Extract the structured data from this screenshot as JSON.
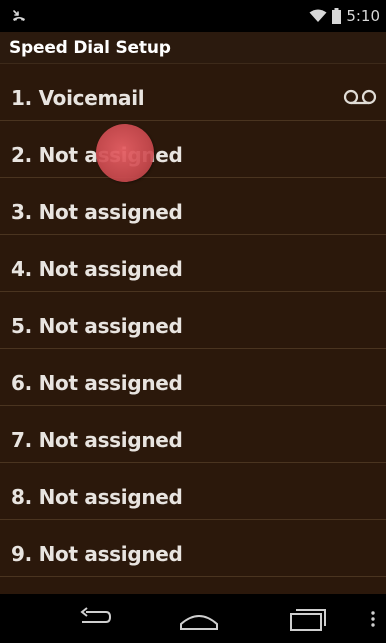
{
  "status_bar": {
    "time": "5:10",
    "left_icon": "missed-call-icon",
    "wifi_icon": "wifi-icon",
    "battery_icon": "battery-icon"
  },
  "action_bar": {
    "title": "Speed Dial Setup"
  },
  "speed_dial": {
    "items": [
      {
        "label": "1. Voicemail",
        "icon": "voicemail-icon"
      },
      {
        "label": "2. Not assigned"
      },
      {
        "label": "3. Not assigned"
      },
      {
        "label": "4. Not assigned"
      },
      {
        "label": "5. Not assigned"
      },
      {
        "label": "6. Not assigned"
      },
      {
        "label": "7. Not assigned"
      },
      {
        "label": "8. Not assigned"
      },
      {
        "label": "9. Not assigned"
      }
    ]
  },
  "navigation_bar": {
    "back_icon": "back-icon",
    "home_icon": "home-icon",
    "recents_icon": "recent-apps-icon",
    "menu_icon": "overflow-menu-icon"
  },
  "colors": {
    "list_background": "#2b180b",
    "divider": "#4a3420",
    "text": "#e8e4e0",
    "touch_indicator": "#d85a60"
  }
}
